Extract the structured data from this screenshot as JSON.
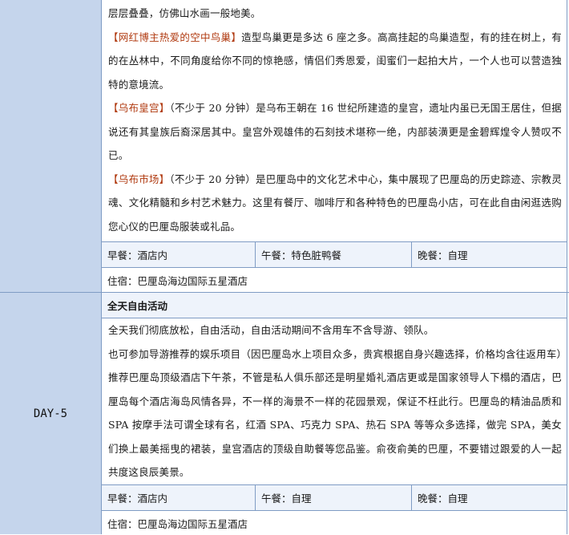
{
  "day4": {
    "paragraphs": [
      {
        "lead": "",
        "text": "层层叠叠，仿佛山水画一般地美。"
      },
      {
        "lead": "【网红博主热爱的空中鸟巢】",
        "text": "造型鸟巢更是多达 6 座之多。高高挂起的鸟巢造型，有的挂在树上，有的在丛林中，不同角度给你不同的惊艳感，情侣们秀恩爱，闺蜜们一起拍大片，一个人也可以营造独特的意境流。"
      },
      {
        "lead": "【乌布皇宫】",
        "text": "（不少于 20 分钟）是乌布王朝在 16 世纪所建造的皇宫，遗址内虽已无国王居住，但据说还有其皇族后裔深居其中。皇宫外观雄伟的石刻技术堪称一绝，内部装潢更是金碧辉煌令人赞叹不已。"
      },
      {
        "lead": "【乌布市场】",
        "text": "（不少于 20 分钟）是巴厘岛中的文化艺术中心，集中展现了巴厘岛的历史踪迹、宗教灵魂、文化精髓和乡村艺术魅力。这里有餐厅、咖啡厅和各种特色的巴厘岛小店，可在此自由闲逛选购您心仪的巴厘岛服装或礼品。"
      }
    ],
    "breakfast": "早餐：酒店内",
    "lunch": "午餐：特色脏鸭餐",
    "dinner": "晚餐：自理",
    "stay": "住宿：巴厘岛海边国际五星酒店"
  },
  "day5": {
    "label": "DAY-5",
    "title": "全天自由活动",
    "paragraphs": [
      "全天我们彻底放松，自由活动，自由活动期间不含用车不含导游、领队。",
      "也可参加导游推荐的娱乐项目（因巴厘岛水上项目众多，贵宾根据自身兴趣选择，价格均含往返用车）推荐巴厘岛顶级酒店下午茶，不管是私人俱乐部还是明星婚礼酒店更或是国家领导人下榻的酒店，巴厘岛每个酒店海岛风情各异，不一样的海景不一样的花园景观，保证不枉此行。巴厘岛的精油品质和 SPA 按摩手法可谓全球有名，红酒 SPA、巧克力 SPA、热石 SPA 等等众多选择，做完 SPA，美女们换上最美摇曳的裙装，皇宫酒店的顶级自助餐等您品鉴。俞夜俞美的巴厘，不要错过跟爱的人一起共度这良辰美景。"
    ],
    "breakfast": "早餐：酒店内",
    "lunch": "午餐：自理",
    "dinner": "晚餐：自理",
    "stay": "住宿：巴厘岛海边国际五星酒店"
  }
}
